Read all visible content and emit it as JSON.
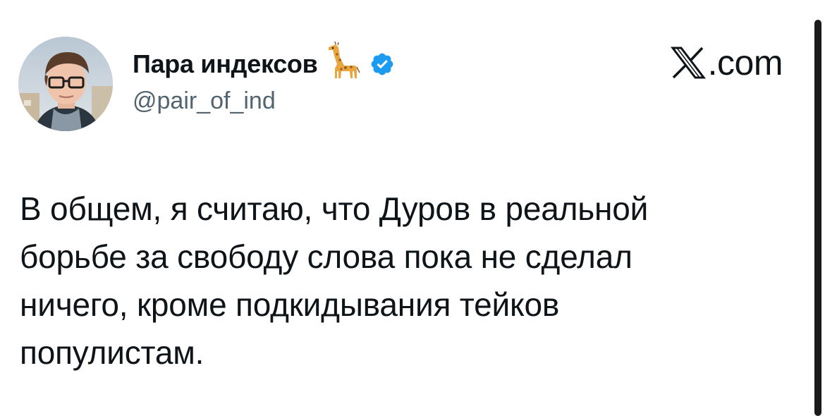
{
  "author": {
    "display_name": "Пара индексов",
    "handle": "@pair_of_ind",
    "emoji_icon": "giraffe-icon",
    "verified_icon": "verified-badge-icon",
    "verified_color": "#1d9bf0"
  },
  "brand": {
    "label": ".com",
    "logo_icon": "x-logo-icon"
  },
  "tweet": {
    "lines": [
      "В общем, я считаю, что Дуров в реальной",
      "борьбе за свободу слова пока не сделал",
      "ничего, кроме подкидывания тейков",
      "популистам."
    ]
  },
  "colors": {
    "text": "#0f1419",
    "secondary_text": "#536471",
    "background": "#ffffff"
  }
}
